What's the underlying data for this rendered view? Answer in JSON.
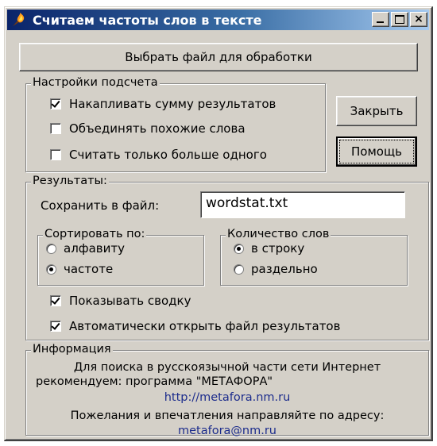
{
  "window": {
    "title": "Считаем частоты слов в тексте",
    "icon": "flame-icon",
    "caption_buttons": {
      "minimize": "_",
      "maximize": "□",
      "close": "×"
    }
  },
  "select_file_button": "Выбрать файл для обработки",
  "settings": {
    "group_label": "Настройки подсчета",
    "items": [
      {
        "label": "Накапливать сумму результатов",
        "checked": true
      },
      {
        "label": "Объединять похожие слова",
        "checked": false
      },
      {
        "label": "Считать только больше одного",
        "checked": false
      }
    ]
  },
  "close_button": "Закрыть",
  "help_button": "Помощь",
  "results": {
    "group_label": "Результаты:",
    "save_label": "Сохранить в файл:",
    "save_value": "wordstat.txt",
    "sort": {
      "group_label": "Сортировать по:",
      "options": [
        {
          "label": "алфавиту",
          "selected": false
        },
        {
          "label": "частоте",
          "selected": true
        }
      ]
    },
    "count": {
      "group_label": "Количество слов",
      "options": [
        {
          "label": "в строку",
          "selected": true
        },
        {
          "label": "раздельно",
          "selected": false
        }
      ]
    },
    "show_summary": {
      "label": "Показывать сводку",
      "checked": true
    },
    "auto_open": {
      "label": "Автоматически открыть файл результатов",
      "checked": true
    }
  },
  "info": {
    "group_label": "Информация",
    "line1": "Для поиска в русскоязычной части сети Интернет",
    "line2": "рекомендуем:  программа \"МЕТАФОРА\"",
    "link1": "http://metafora.nm.ru",
    "line3": "Пожелания и впечатления направляйте по адресу:",
    "link2": "metafora@nm.ru"
  }
}
